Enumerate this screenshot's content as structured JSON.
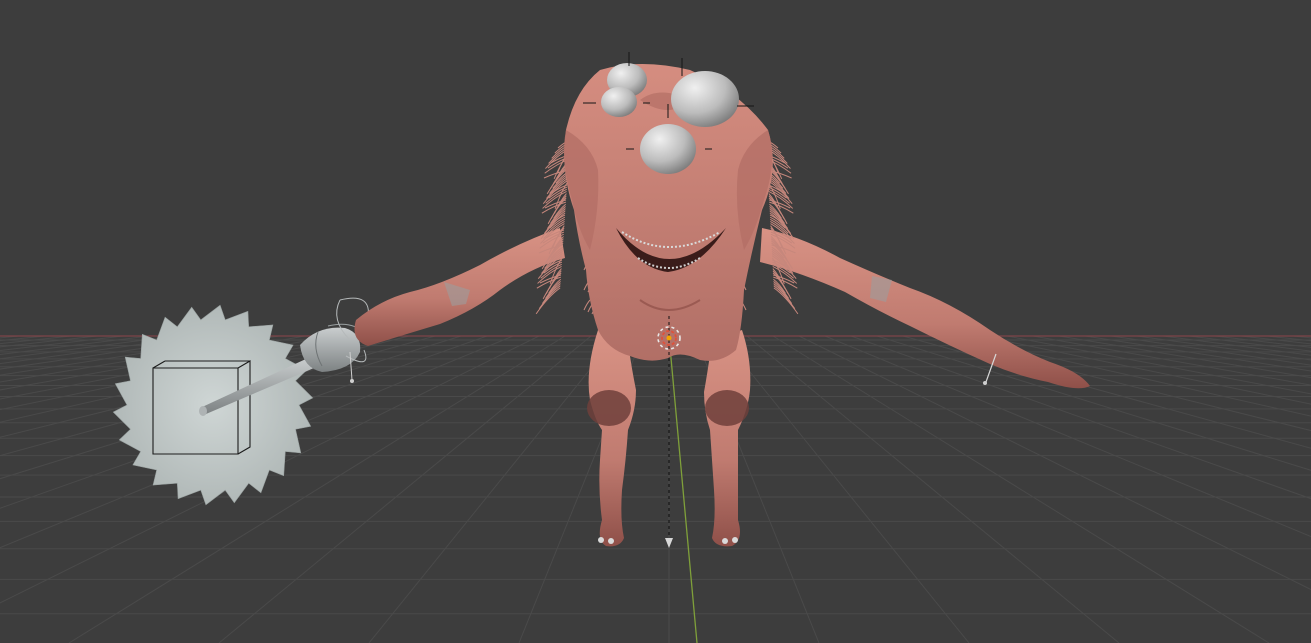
{
  "viewport": {
    "kind": "3d-viewport",
    "scene": "character-model-t-pose",
    "colors": {
      "background": "#3d3d3d",
      "grid_line": "#4a4a4a",
      "x_axis": "#8a4a4e",
      "y_axis": "#7a9a3a",
      "skin": "#c98276",
      "skin_shadow": "#8f4f48",
      "eye": "#bdbdbd",
      "blade": "#c3cbca",
      "handle": "#9ea3a4"
    }
  },
  "objects": [
    {
      "name": "creature-body",
      "type": "mesh"
    },
    {
      "name": "eye-top-left",
      "type": "mesh"
    },
    {
      "name": "eye-top-right",
      "type": "mesh"
    },
    {
      "name": "eye-center",
      "type": "mesh"
    },
    {
      "name": "eye-small",
      "type": "mesh"
    },
    {
      "name": "saw-blade",
      "type": "mesh"
    },
    {
      "name": "saw-handle",
      "type": "mesh"
    },
    {
      "name": "empty-cube",
      "type": "empty"
    },
    {
      "name": "armature-origin",
      "type": "origin"
    }
  ]
}
